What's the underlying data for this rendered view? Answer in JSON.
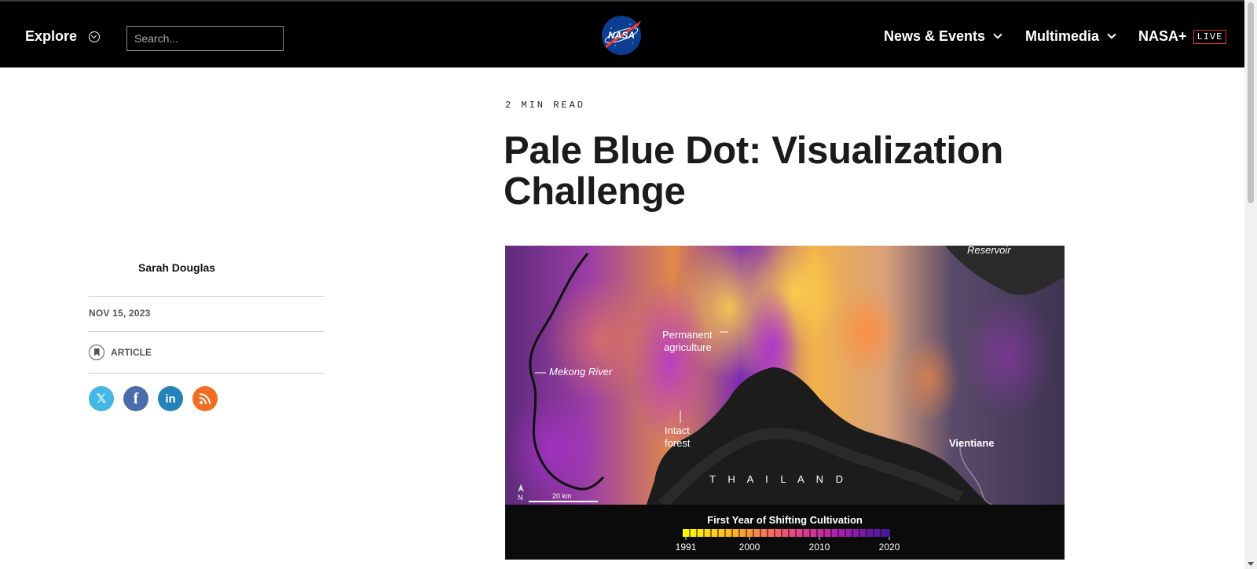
{
  "header": {
    "explore_label": "Explore",
    "search_placeholder": "Search...",
    "nav": [
      {
        "label": "News & Events"
      },
      {
        "label": "Multimedia"
      },
      {
        "label": "NASA+"
      }
    ],
    "live_badge": "LIVE"
  },
  "article": {
    "read_time": "2 MIN READ",
    "title": "Pale Blue Dot: Visualization Challenge",
    "author": "Sarah Douglas",
    "date": "NOV 15, 2023",
    "type": "ARTICLE",
    "share": [
      {
        "icon": "x-icon",
        "color": "#45b7e5"
      },
      {
        "icon": "facebook-icon",
        "color": "#4c6dab"
      },
      {
        "icon": "linkedin-icon",
        "color": "#2482b9"
      },
      {
        "icon": "rss-icon",
        "color": "#f06d24"
      }
    ]
  },
  "image": {
    "labels": {
      "reservoir": "Reservoir",
      "permanent_1": "Permanent",
      "permanent_2": "agriculture",
      "mekong": "Mekong River",
      "intact_1": "Intact",
      "intact_2": "forest",
      "vientiane": "Vientiane",
      "thailand": "T H A I L A N D",
      "scale": "20 km",
      "legend_title": "First Year of Shifting Cultivation",
      "year_1": "1991",
      "year_2": "2000",
      "year_3": "2010",
      "year_4": "2020"
    }
  }
}
